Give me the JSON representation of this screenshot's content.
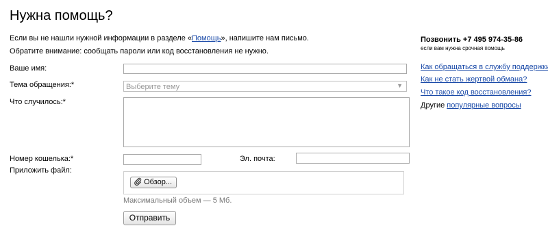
{
  "page": {
    "title": "Нужна помощь?"
  },
  "intro": {
    "line1_before": "Если вы не нашли нужной информации в разделе «",
    "line1_link": "Помощь",
    "line1_after": "», напишите нам письмо.",
    "line2": "Обратите внимание: сообщать пароли или код восстановления не нужно."
  },
  "form": {
    "name_label": "Ваше имя:",
    "name_value": "",
    "topic_label": "Тема обращения:*",
    "topic_placeholder": "Выберите тему",
    "what_label": "Что случилось:*",
    "what_value": "",
    "wallet_label": "Номер кошелька:*",
    "wallet_value": "",
    "email_label": "Эл. почта:",
    "email_value": "",
    "attach_label": "Приложить файл:",
    "browse_label": "Обзор...",
    "max_size_hint": "Максимальный объем — 5 Мб.",
    "submit_label": "Отправить"
  },
  "sidebar": {
    "phone": "Позвонить +7 495 974-35-86",
    "phone_note": "если вам нужна срочная помощь",
    "links": [
      "Как обращаться в службу поддержки?",
      "Как не стать жертвой обмана?",
      "Что такое код восстановления?"
    ],
    "other_prefix": "Другие ",
    "other_link": "популярные вопросы"
  },
  "colors": {
    "link": "#1a4aa8",
    "border": "#a9a9a9",
    "hint": "#777777"
  }
}
